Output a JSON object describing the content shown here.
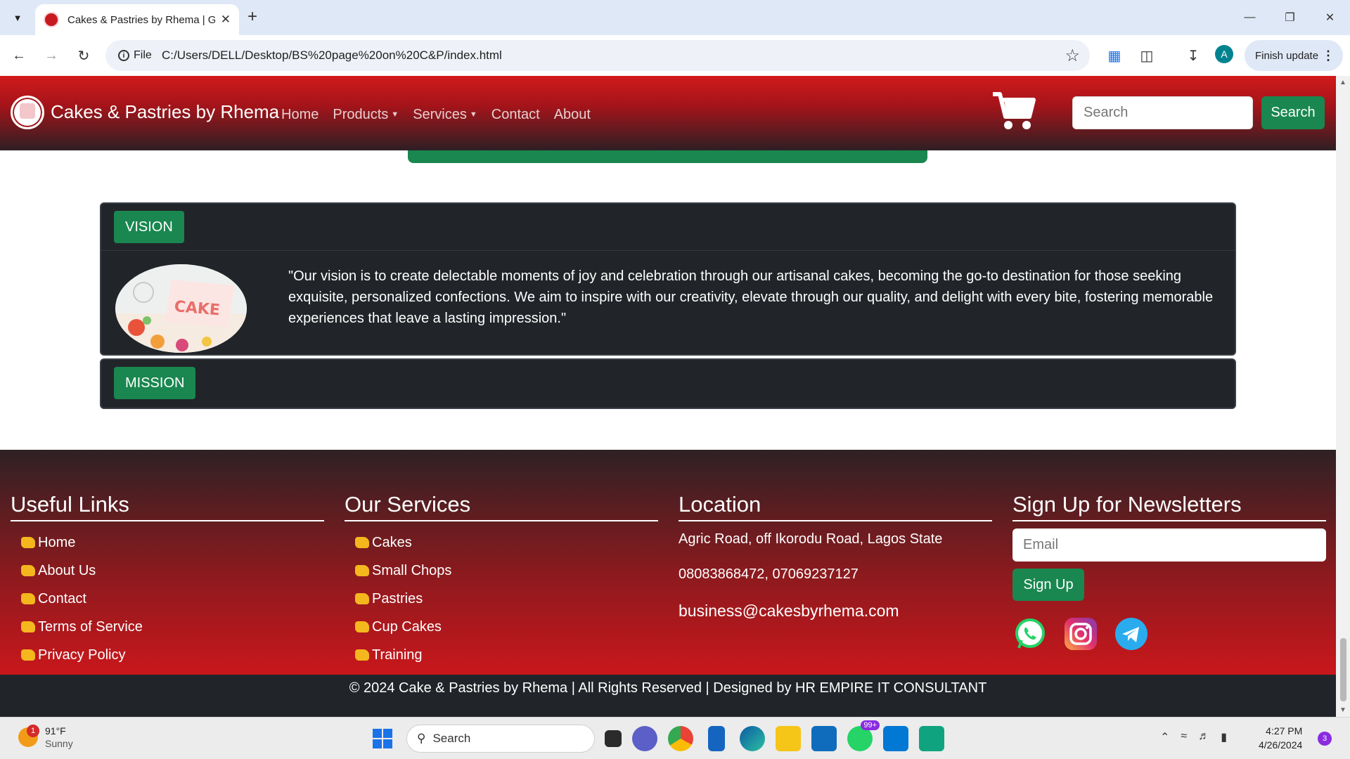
{
  "browser": {
    "tab_title": "Cakes & Pastries by Rhema | Gi",
    "site_chip": "File",
    "url": "C:/Users/DELL/Desktop/BS%20page%20on%20C&P/index.html",
    "profile_initial": "A",
    "finish_update": "Finish update"
  },
  "site": {
    "brand": "Cakes & Pastries by Rhema",
    "menu": {
      "home": "Home",
      "products": "Products",
      "services": "Services",
      "contact": "Contact",
      "about": "About"
    },
    "search_placeholder": "Search",
    "search_button": "Search"
  },
  "vision": {
    "label": "VISION",
    "text": "\"Our vision is to create delectable moments of joy and celebration through our artisanal cakes, becoming the go-to destination for those seeking exquisite, personalized confections. We aim to inspire with our creativity, elevate through our quality, and delight with every bite, fostering memorable experiences that leave a lasting impression.\"",
    "image_text": "CAKE"
  },
  "mission": {
    "label": "MISSION"
  },
  "footer": {
    "useful_links": {
      "title": "Useful Links",
      "items": [
        "Home",
        "About Us",
        "Contact",
        "Terms of Service",
        "Privacy Policy"
      ]
    },
    "services": {
      "title": "Our Services",
      "items": [
        "Cakes",
        "Small Chops",
        "Pastries",
        "Cup Cakes",
        "Training"
      ]
    },
    "location": {
      "title": "Location",
      "address": "Agric Road, off Ikorodu Road, Lagos State",
      "phones": "08083868472, 07069237127",
      "email": "business@cakesbyrhema.com"
    },
    "newsletter": {
      "title": "Sign Up for Newsletters",
      "email_placeholder": "Email",
      "button": "Sign Up"
    },
    "copyright": "© 2024 Cake & Pastries by Rhema | All Rights Reserved | Designed by HR EMPIRE IT CONSULTANT"
  },
  "taskbar": {
    "weather_temp": "91°F",
    "weather_desc": "Sunny",
    "weather_badge": "1",
    "search": "Search",
    "whatsapp_badge": "99+",
    "time": "4:27 PM",
    "date": "4/26/2024",
    "notifications": "3"
  },
  "colors": {
    "brand_red": "#c9171c",
    "brand_green": "#19874f",
    "card_dark": "#212529"
  }
}
